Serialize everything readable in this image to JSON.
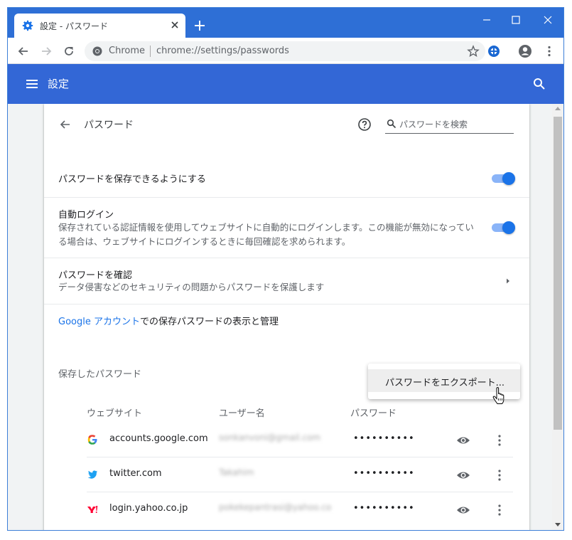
{
  "tab": {
    "title": "設定 - パスワード"
  },
  "omnibox": {
    "chip": "Chrome",
    "url": "chrome://settings/passwords"
  },
  "header": {
    "title": "設定"
  },
  "page": {
    "title": "パスワード",
    "search_placeholder": "パスワードを検索"
  },
  "settings": {
    "offer_save": {
      "label": "パスワードを保存できるようにする",
      "enabled": true
    },
    "auto_signin": {
      "label": "自動ログイン",
      "description": "保存されている認証情報を使用してウェブサイトに自動的にログインします。この機能が無効になっている場合は、ウェブサイトにログインするときに毎回確認を求められます。",
      "enabled": true
    },
    "check_passwords": {
      "label": "パスワードを確認",
      "description": "データ侵害などのセキュリティの問題からパスワードを保護します"
    },
    "google_account": {
      "link": "Google アカウント",
      "rest": "での保存パスワードの表示と管理"
    }
  },
  "saved": {
    "title": "保存したパスワード",
    "export_menu_item": "パスワードをエクスポート...",
    "columns": {
      "website": "ウェブサイト",
      "username": "ユーザー名",
      "password": "パスワード"
    },
    "rows": [
      {
        "site": "accounts.google.com",
        "username": "sonkanvoni@gmail.com",
        "password": "••••••••••",
        "icon": "google-icon"
      },
      {
        "site": "twitter.com",
        "username": "Takahim",
        "password": "••••••••••",
        "icon": "twitter-icon"
      },
      {
        "site": "login.yahoo.co.jp",
        "username": "pokekepantrasi@yahoo.co",
        "password": "••••••••••",
        "icon": "yahoo-icon"
      }
    ]
  },
  "colors": {
    "accent": "#3367d6",
    "toggle": "#1a73e8",
    "link": "#1a73e8",
    "titlebar": "#2e6fd6"
  }
}
